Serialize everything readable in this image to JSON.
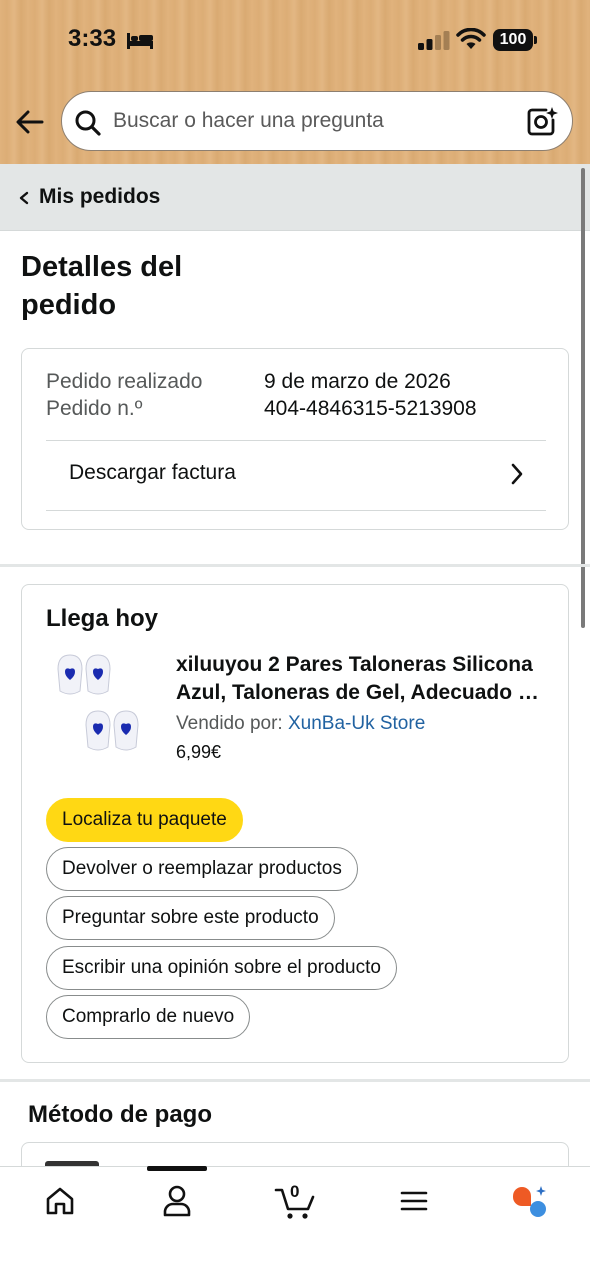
{
  "status_bar": {
    "time": "3:33",
    "battery": "100"
  },
  "header": {
    "search_placeholder": "Buscar o hacer una pregunta"
  },
  "breadcrumb": {
    "label": "Mis pedidos"
  },
  "page": {
    "title": "Detalles del pedido"
  },
  "order_info": {
    "date_label": "Pedido realizado",
    "date_value": "9 de marzo de 2026",
    "number_label": "Pedido n.º",
    "number_value": "404-4846315-5213908",
    "invoice_label": "Descargar factura"
  },
  "shipment": {
    "status": "Llega hoy",
    "product_title_line1": "xiluuyou 2 Pares Taloneras Silicona",
    "product_title_line2": "Azul, Taloneras de Gel, Adecuado para Todo",
    "seller_prefix": "Vendido por:",
    "seller_name": "XunBa-Uk Store",
    "price": "6,99€",
    "buttons": [
      "Localiza tu paquete",
      "Devolver o reemplazar productos",
      "Preguntar sobre este producto",
      "Escribir una opinión sobre el producto",
      "Comprarlo de nuevo"
    ]
  },
  "payment": {
    "title": "Método de pago"
  },
  "bottom_nav": {
    "cart_count": "0",
    "items": [
      "home-icon",
      "account-icon",
      "cart-icon",
      "menu-icon",
      "rufus-icon"
    ]
  },
  "colors": {
    "header_bg": "#e0b27c",
    "primary_button": "#ffd814",
    "link": "#2162a1",
    "product_heart": "#1a2bb0"
  }
}
